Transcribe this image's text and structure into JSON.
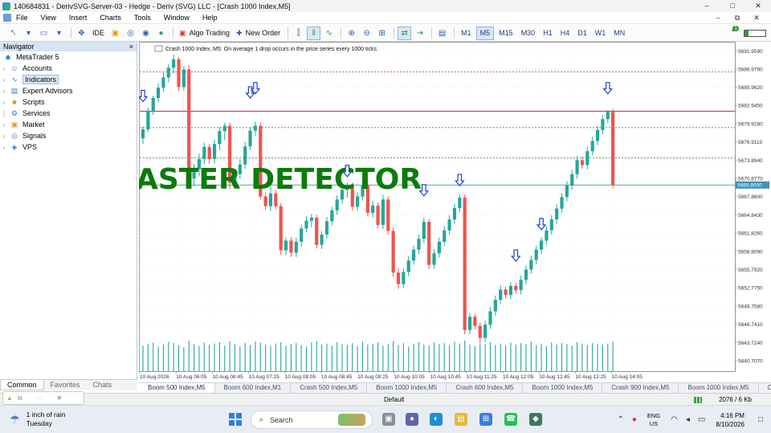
{
  "window": {
    "title": "140684831 - DerivSVG-Server-03 - Hedge - Deriv (SVG) LLC - [Crash 1000 Index,M5]",
    "controls": [
      "–",
      "□",
      "✕"
    ]
  },
  "menu": {
    "items": [
      "File",
      "View",
      "Insert",
      "Charts",
      "Tools",
      "Window",
      "Help"
    ],
    "right_controls": [
      "–",
      "⧉",
      "✕"
    ]
  },
  "toolbar": {
    "ide_label": "IDE",
    "algo_trading_label": "Algo Trading",
    "new_order_label": "New Order",
    "timeframes": [
      "M1",
      "M5",
      "M15",
      "M30",
      "H1",
      "H4",
      "D1",
      "W1",
      "MN"
    ],
    "selected_timeframe": "M5",
    "notification_count": "1"
  },
  "navigator": {
    "title": "Navigator",
    "close": "×",
    "root": "MetaTrader 5",
    "items": [
      {
        "label": "Accounts",
        "icon": "accounts-icon"
      },
      {
        "label": "Indicators",
        "icon": "indicators-icon",
        "selected": true
      },
      {
        "label": "Expert Advisors",
        "icon": "expert-advisors-icon"
      },
      {
        "label": "Scripts",
        "icon": "scripts-icon"
      },
      {
        "label": "Services",
        "icon": "services-icon"
      },
      {
        "label": "Market",
        "icon": "market-icon"
      },
      {
        "label": "Signals",
        "icon": "signals-icon"
      },
      {
        "label": "VPS",
        "icon": "vps-icon"
      }
    ],
    "tabs": [
      "Common",
      "Favorites",
      "Chats"
    ],
    "selected_tab": "Common"
  },
  "chart_data": {
    "type": "candlestick",
    "title": "Crash 1000 Index, M5:  On average 1 drop occurs in the price series every 1000 ticks",
    "watermark": "ASTER DETECTOR",
    "ylim": [
      5639.0,
      5693.5
    ],
    "y_ticks": [
      "5691.9590",
      "5688.9790",
      "5685.9620",
      "5682.9450",
      "5679.9280",
      "5676.9110",
      "5673.8940",
      "5670.8770",
      "5667.8600",
      "5664.8430",
      "5661.8260",
      "5658.8090",
      "5655.7920",
      "5652.7750",
      "5649.7580",
      "5646.7410",
      "5643.7240",
      "5640.7070"
    ],
    "y_tick_values": [
      5691.959,
      5688.979,
      5685.962,
      5682.945,
      5679.928,
      5676.911,
      5673.894,
      5670.877,
      5667.86,
      5664.843,
      5661.826,
      5658.809,
      5655.792,
      5652.775,
      5649.758,
      5646.741,
      5643.724,
      5640.707
    ],
    "x_labels": [
      "10 Aug 2026",
      "10 Aug 06:05",
      "10 Aug 06:45",
      "10 Aug 07:25",
      "10 Aug 08:05",
      "10 Aug 08:45",
      "10 Aug 09:25",
      "10 Aug 10:05",
      "10 Aug 10:45",
      "10 Aug 11:25",
      "10 Aug 12:05",
      "10 Aug 12:45",
      "10 Aug 13:25",
      "10 Aug 14:05"
    ],
    "current_price": "5669.8000",
    "current_price_value": 5669.8,
    "levels": [
      {
        "value": 5688.5,
        "style": "dotted",
        "color": "#c0392b"
      },
      {
        "value": 5682.0,
        "style": "solid",
        "color": "#d4377a"
      },
      {
        "value": 5679.3,
        "style": "dotted",
        "color": "#2e9e3a"
      },
      {
        "value": 5674.3,
        "style": "dotted",
        "color": "#2e9e3a"
      }
    ],
    "arrow_prices": [
      5683.6,
      5684.2,
      5684.9,
      5671.2,
      5668.0,
      5669.7,
      5657.2,
      5662.4,
      5684.9
    ],
    "arrow_bars": [
      0,
      21,
      22,
      40,
      55,
      62,
      73,
      78,
      91
    ],
    "colors": {
      "up": "#26a69a",
      "down": "#ef5350",
      "arrow": "#1a3fd0",
      "volume": "#26a69a"
    },
    "candles": [
      [
        5677.5,
        5679.5,
        5676.6,
        5679.0
      ],
      [
        5679.0,
        5682.6,
        5678.6,
        5682.0
      ],
      [
        5682.0,
        5684.6,
        5681.4,
        5684.2
      ],
      [
        5684.2,
        5686.6,
        5683.5,
        5685.9
      ],
      [
        5685.9,
        5688.4,
        5685.2,
        5687.6
      ],
      [
        5687.6,
        5689.8,
        5686.8,
        5689.2
      ],
      [
        5689.2,
        5691.4,
        5688.3,
        5690.6
      ],
      [
        5690.6,
        5691.0,
        5685.4,
        5686.0
      ],
      [
        5686.0,
        5689.5,
        5685.4,
        5688.9
      ],
      [
        5688.9,
        5689.6,
        5670.1,
        5670.9
      ],
      [
        5670.9,
        5673.3,
        5669.6,
        5672.4
      ],
      [
        5672.4,
        5675.0,
        5671.2,
        5674.1
      ],
      [
        5674.1,
        5676.8,
        5673.2,
        5676.1
      ],
      [
        5676.1,
        5676.6,
        5673.3,
        5674.1
      ],
      [
        5674.1,
        5677.3,
        5673.4,
        5676.6
      ],
      [
        5676.6,
        5679.4,
        5675.6,
        5678.7
      ],
      [
        5678.7,
        5680.1,
        5677.2,
        5679.6
      ],
      [
        5679.6,
        5680.1,
        5669.2,
        5670.2
      ],
      [
        5670.2,
        5672.3,
        5669.4,
        5671.6
      ],
      [
        5671.6,
        5674.1,
        5670.8,
        5673.2
      ],
      [
        5673.2,
        5676.9,
        5672.5,
        5676.2
      ],
      [
        5676.2,
        5679.4,
        5675.6,
        5678.8
      ],
      [
        5678.8,
        5680.3,
        5677.9,
        5679.6
      ],
      [
        5679.6,
        5680.2,
        5667.4,
        5667.9
      ],
      [
        5667.9,
        5668.6,
        5665.7,
        5666.3
      ],
      [
        5666.3,
        5669.5,
        5665.5,
        5668.4
      ],
      [
        5668.4,
        5669.0,
        5665.8,
        5666.3
      ],
      [
        5666.3,
        5666.8,
        5658.2,
        5659.0
      ],
      [
        5659.0,
        5661.1,
        5658.2,
        5660.6
      ],
      [
        5660.6,
        5661.2,
        5657.9,
        5658.6
      ],
      [
        5658.6,
        5661.1,
        5657.9,
        5660.4
      ],
      [
        5660.4,
        5663.2,
        5659.6,
        5662.6
      ],
      [
        5662.6,
        5664.6,
        5662.0,
        5663.9
      ],
      [
        5663.9,
        5665.0,
        5662.8,
        5664.4
      ],
      [
        5664.4,
        5664.9,
        5659.3,
        5659.9
      ],
      [
        5659.9,
        5662.2,
        5659.2,
        5661.6
      ],
      [
        5661.6,
        5664.5,
        5660.9,
        5663.8
      ],
      [
        5663.8,
        5666.2,
        5663.1,
        5665.6
      ],
      [
        5665.6,
        5668.1,
        5664.9,
        5667.4
      ],
      [
        5667.4,
        5669.7,
        5666.7,
        5669.0
      ],
      [
        5669.0,
        5670.2,
        5667.7,
        5669.7
      ],
      [
        5669.7,
        5670.1,
        5665.6,
        5666.2
      ],
      [
        5666.2,
        5668.6,
        5665.5,
        5667.9
      ],
      [
        5667.9,
        5670.3,
        5667.2,
        5669.7
      ],
      [
        5669.7,
        5670.2,
        5664.6,
        5665.2
      ],
      [
        5665.2,
        5667.2,
        5664.4,
        5666.4
      ],
      [
        5666.4,
        5666.9,
        5662.6,
        5663.2
      ],
      [
        5663.2,
        5668.2,
        5662.5,
        5667.4
      ],
      [
        5667.4,
        5667.9,
        5661.6,
        5662.2
      ],
      [
        5662.2,
        5662.8,
        5654.6,
        5655.3
      ],
      [
        5655.3,
        5656.0,
        5652.6,
        5653.4
      ],
      [
        5653.4,
        5656.0,
        5652.8,
        5655.4
      ],
      [
        5655.4,
        5658.0,
        5654.7,
        5657.3
      ],
      [
        5657.3,
        5659.8,
        5656.6,
        5659.1
      ],
      [
        5659.1,
        5661.6,
        5658.4,
        5660.9
      ],
      [
        5660.9,
        5664.4,
        5660.2,
        5663.7
      ],
      [
        5663.7,
        5664.2,
        5655.9,
        5656.6
      ],
      [
        5656.6,
        5659.2,
        5655.9,
        5658.5
      ],
      [
        5658.5,
        5661.1,
        5657.8,
        5660.4
      ],
      [
        5660.4,
        5663.0,
        5659.7,
        5662.3
      ],
      [
        5662.3,
        5664.8,
        5661.6,
        5664.1
      ],
      [
        5664.1,
        5666.7,
        5663.4,
        5666.0
      ],
      [
        5666.0,
        5668.3,
        5665.3,
        5667.7
      ],
      [
        5667.7,
        5668.2,
        5645.1,
        5645.8
      ],
      [
        5645.8,
        5648.6,
        5645.1,
        5648.0
      ],
      [
        5648.0,
        5648.5,
        5645.9,
        5646.5
      ],
      [
        5646.5,
        5647.0,
        5643.7,
        5644.5
      ],
      [
        5644.5,
        5647.4,
        5643.8,
        5646.7
      ],
      [
        5646.7,
        5649.6,
        5646.0,
        5648.9
      ],
      [
        5648.9,
        5651.5,
        5648.2,
        5650.8
      ],
      [
        5650.8,
        5653.2,
        5650.1,
        5652.5
      ],
      [
        5652.5,
        5653.0,
        5651.0,
        5651.6
      ],
      [
        5651.6,
        5653.7,
        5650.9,
        5653.1
      ],
      [
        5653.1,
        5653.6,
        5651.8,
        5652.4
      ],
      [
        5652.4,
        5654.8,
        5651.7,
        5654.1
      ],
      [
        5654.1,
        5656.5,
        5653.4,
        5655.8
      ],
      [
        5655.8,
        5658.1,
        5655.1,
        5657.4
      ],
      [
        5657.4,
        5659.8,
        5656.7,
        5659.1
      ],
      [
        5659.1,
        5661.2,
        5658.4,
        5660.6
      ],
      [
        5660.6,
        5663.0,
        5659.9,
        5662.3
      ],
      [
        5662.3,
        5664.8,
        5661.6,
        5664.1
      ],
      [
        5664.1,
        5666.6,
        5663.4,
        5665.9
      ],
      [
        5665.9,
        5668.5,
        5665.2,
        5667.8
      ],
      [
        5667.8,
        5670.4,
        5667.1,
        5669.7
      ],
      [
        5669.7,
        5672.3,
        5669.0,
        5671.6
      ],
      [
        5671.6,
        5674.6,
        5670.9,
        5673.9
      ],
      [
        5673.9,
        5674.5,
        5672.5,
        5673.1
      ],
      [
        5673.1,
        5676.1,
        5672.4,
        5675.4
      ],
      [
        5675.4,
        5677.8,
        5674.7,
        5677.1
      ],
      [
        5677.1,
        5679.6,
        5676.4,
        5678.9
      ],
      [
        5678.9,
        5681.4,
        5678.2,
        5680.7
      ],
      [
        5680.7,
        5682.2,
        5680.0,
        5681.9
      ],
      [
        5681.9,
        5682.4,
        5669.3,
        5669.8
      ]
    ],
    "volumes": [
      52,
      55,
      58,
      50,
      54,
      60,
      57,
      53,
      49,
      62,
      55,
      51,
      58,
      54,
      56,
      59,
      52,
      61,
      55,
      50,
      57,
      53,
      60,
      58,
      54,
      51,
      56,
      59,
      52,
      55,
      57,
      53,
      50,
      58,
      61,
      54,
      56,
      52,
      59,
      55,
      53,
      57,
      51,
      60,
      54,
      56,
      58,
      52,
      55,
      61,
      53,
      57,
      50,
      56,
      59,
      54,
      52,
      58,
      55,
      57,
      53,
      60,
      56,
      62,
      54,
      51,
      57,
      55,
      59,
      53,
      56,
      52,
      58,
      54,
      57,
      55,
      60,
      53,
      56,
      51,
      58,
      54,
      57,
      55,
      52,
      59,
      56,
      53,
      57,
      55,
      54,
      56,
      60
    ]
  },
  "symbol_tabs": [
    "Boom 500 Index,M5",
    "Boom 600 Index,M1",
    "Crash 500 Index,M5",
    "Boom 1000 Index,M5",
    "Crash 600 Index,M5",
    "Boom 1000 Index,M5",
    "Crash 900 Index,M5",
    "Boom 1000 Index,M5",
    "Cras"
  ],
  "selected_symbol_tab": 0,
  "status": {
    "profile": "Default",
    "network": "2076 / 6 Kb"
  },
  "taskbar": {
    "weather_line1": "1 inch of rain",
    "weather_line2": "Tuesday",
    "search_placeholder": "Search",
    "lang_line1": "ENG",
    "lang_line2": "US",
    "time": "4:16 PM",
    "date": "8/10/2026"
  }
}
